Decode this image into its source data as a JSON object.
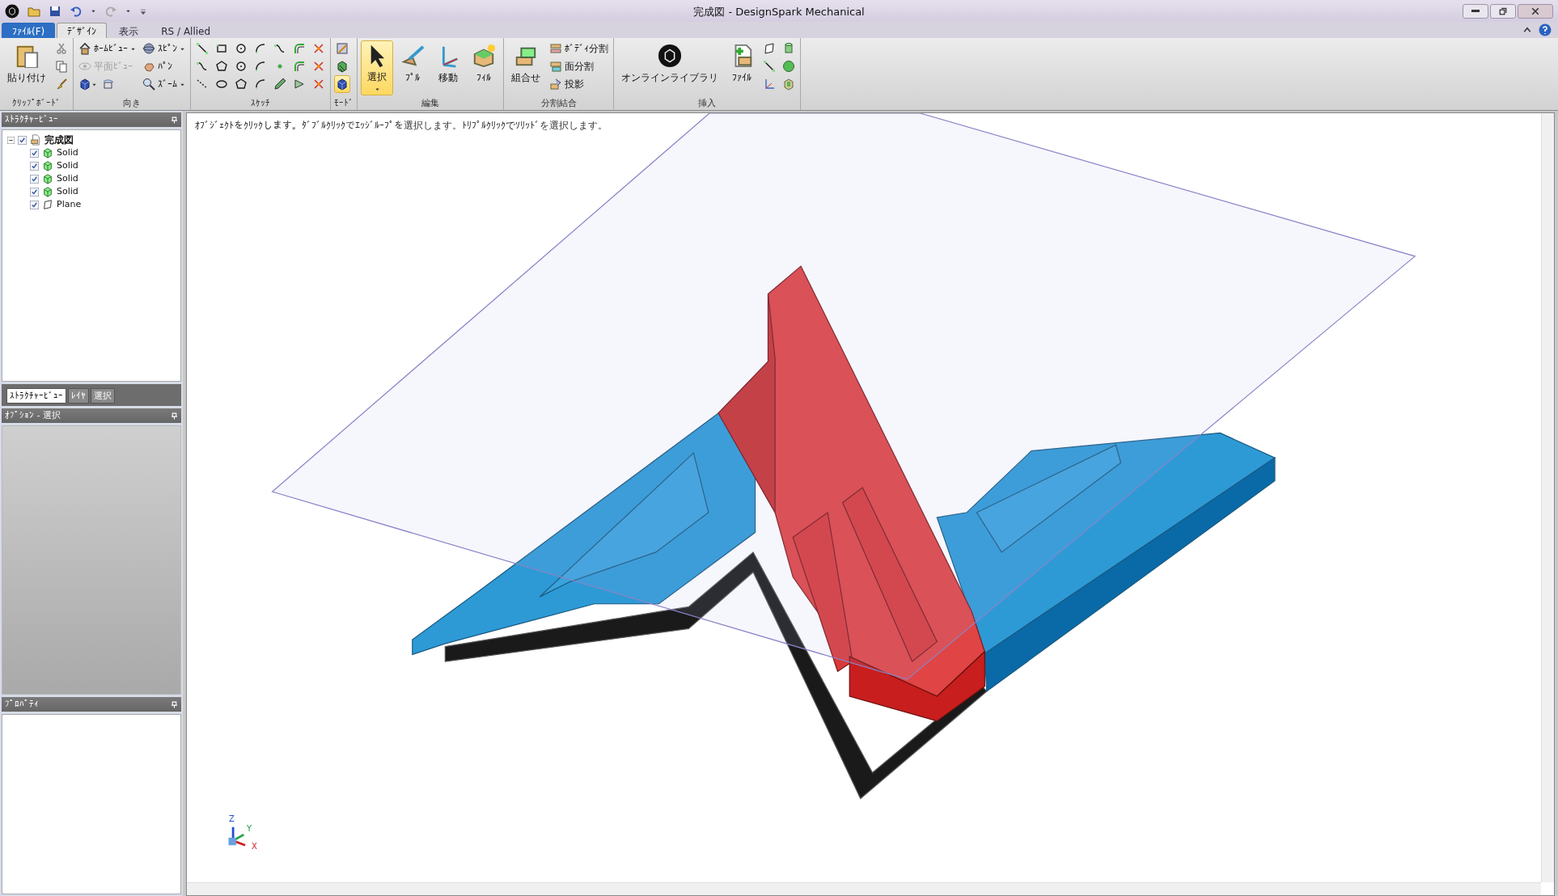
{
  "window": {
    "title": "完成図 - DesignSpark Mechanical"
  },
  "ribbon_tabs": [
    {
      "label": "ﾌｧｲﾙ(F)",
      "kind": "file",
      "selected": false
    },
    {
      "label": "ﾃﾞｻﾞｲﾝ",
      "kind": "tab",
      "selected": true
    },
    {
      "label": "表示",
      "kind": "tab",
      "selected": false
    },
    {
      "label": "RS / Allied",
      "kind": "tab",
      "selected": false
    }
  ],
  "ribbon_groups": [
    {
      "label": "ｸﾘｯﾌﾟﾎﾞｰﾄﾞ",
      "columns": [
        [
          [
            {
              "kind": "large",
              "label": "貼り付け"
            }
          ]
        ],
        [
          [
            {
              "kind": "icon",
              "disabled": true
            }
          ],
          [
            {
              "kind": "icon",
              "disabled": false
            }
          ],
          [
            {
              "kind": "icon",
              "disabled": false
            }
          ]
        ]
      ]
    },
    {
      "label": "向き",
      "columns": [
        [
          [
            {
              "kind": "small",
              "label": "ﾎｰﾑﾋﾞｭｰ",
              "disabled": false,
              "dropdown": true
            }
          ],
          [
            {
              "kind": "small",
              "label": "平面ﾋﾞｭｰ",
              "disabled": true,
              "dropdown": false
            }
          ],
          [
            {
              "kind": "icon",
              "disabled": false,
              "dropdown": true
            },
            {
              "kind": "icon",
              "disabled": false,
              "dropdown": false
            }
          ]
        ],
        [
          [
            {
              "kind": "small",
              "label": "ｽﾋﾟﾝ",
              "disabled": false,
              "dropdown": true
            }
          ],
          [
            {
              "kind": "small",
              "label": "ﾊﾟﾝ",
              "disabled": false,
              "dropdown": false
            }
          ],
          [
            {
              "kind": "small",
              "label": "ｽﾞｰﾑ",
              "disabled": false,
              "dropdown": true
            }
          ]
        ]
      ]
    },
    {
      "label": "ｽｹｯﾁ",
      "columns": [
        [
          [
            {
              "kind": "icon"
            }
          ],
          [
            {
              "kind": "icon"
            }
          ],
          [
            {
              "kind": "icon"
            }
          ]
        ],
        [
          [
            {
              "kind": "icon"
            }
          ],
          [
            {
              "kind": "icon"
            }
          ],
          [
            {
              "kind": "icon"
            }
          ]
        ],
        [
          [
            {
              "kind": "icon"
            }
          ],
          [
            {
              "kind": "icon"
            }
          ],
          [
            {
              "kind": "icon"
            }
          ]
        ],
        [
          [
            {
              "kind": "icon"
            }
          ],
          [
            {
              "kind": "icon"
            }
          ],
          [
            {
              "kind": "icon"
            }
          ]
        ],
        [
          [
            {
              "kind": "icon"
            }
          ],
          [
            {
              "kind": "icon"
            }
          ],
          [
            {
              "kind": "icon"
            }
          ]
        ],
        [
          [
            {
              "kind": "icon"
            }
          ],
          [
            {
              "kind": "icon"
            }
          ],
          [
            {
              "kind": "icon"
            }
          ]
        ],
        [
          [
            {
              "kind": "icon"
            }
          ],
          [
            {
              "kind": "icon"
            }
          ],
          [
            {
              "kind": "icon"
            }
          ]
        ]
      ]
    },
    {
      "label": "ﾓｰﾄﾞ",
      "columns": [
        [
          [
            {
              "kind": "icon",
              "selected": false
            }
          ],
          [
            {
              "kind": "icon",
              "selected": false
            }
          ],
          [
            {
              "kind": "icon",
              "selected": true
            }
          ]
        ]
      ]
    },
    {
      "label": "編集",
      "columns": [
        [
          [
            {
              "kind": "large",
              "label": "選択",
              "selected": true,
              "dropdown": true
            }
          ]
        ],
        [
          [
            {
              "kind": "large",
              "label": "ﾌﾟﾙ",
              "selected": false,
              "dropdown": false
            }
          ]
        ],
        [
          [
            {
              "kind": "large",
              "label": "移動",
              "selected": false,
              "dropdown": false
            }
          ]
        ],
        [
          [
            {
              "kind": "large",
              "label": "ﾌｨﾙ",
              "selected": false,
              "dropdown": false
            }
          ]
        ]
      ]
    },
    {
      "label": "分割結合",
      "columns": [
        [
          [
            {
              "kind": "large",
              "label": "組合せ"
            }
          ]
        ],
        [
          [
            {
              "kind": "small",
              "label": "ﾎﾞﾃﾞｨ分割"
            }
          ],
          [
            {
              "kind": "small",
              "label": "面分割"
            }
          ],
          [
            {
              "kind": "small",
              "label": "投影"
            }
          ]
        ]
      ]
    },
    {
      "label": "挿入",
      "columns": [
        [
          [
            {
              "kind": "large",
              "label": "オンラインライブラリ"
            }
          ]
        ],
        [
          [
            {
              "kind": "large",
              "label": "ﾌｧｲﾙ"
            }
          ]
        ],
        [
          [
            {
              "kind": "icon"
            }
          ],
          [
            {
              "kind": "icon"
            }
          ],
          [
            {
              "kind": "icon"
            }
          ]
        ],
        [
          [
            {
              "kind": "icon"
            }
          ],
          [
            {
              "kind": "icon"
            }
          ],
          [
            {
              "kind": "icon"
            }
          ]
        ]
      ]
    }
  ],
  "structure_panel": {
    "title": "ｽﾄﾗｸﾁｬｰﾋﾞｭｰ",
    "tree": [
      {
        "label": "完成図",
        "kind": "document",
        "checked": true,
        "expanded": true,
        "children": [
          {
            "label": "Solid",
            "kind": "solid",
            "checked": true
          },
          {
            "label": "Solid",
            "kind": "solid",
            "checked": true
          },
          {
            "label": "Solid",
            "kind": "solid",
            "checked": true
          },
          {
            "label": "Solid",
            "kind": "solid",
            "checked": true
          },
          {
            "label": "Plane",
            "kind": "plane",
            "checked": true
          }
        ]
      }
    ]
  },
  "panel_tabs": [
    {
      "label": "ｽﾄﾗｸﾁｬｰﾋﾞｭｰ",
      "selected": true
    },
    {
      "label": "ﾚｲﾔ",
      "selected": false
    },
    {
      "label": "選択",
      "selected": false
    }
  ],
  "options_panel": {
    "title": "ｵﾌﾟｼｮﾝ - 選択"
  },
  "properties_panel": {
    "title": "ﾌﾟﾛﾊﾟﾃｨ"
  },
  "viewport": {
    "hint": "ｵﾌﾞｼﾞｪｸﾄをｸﾘｯｸします。ﾀﾞﾌﾞﾙｸﾘｯｸでｴｯｼﾞﾙｰﾌﾟを選択します。ﾄﾘﾌﾟﾙｸﾘｯｸでｿﾘｯﾄﾞを選択します。",
    "axes": [
      "Z",
      "Y",
      "X"
    ]
  }
}
